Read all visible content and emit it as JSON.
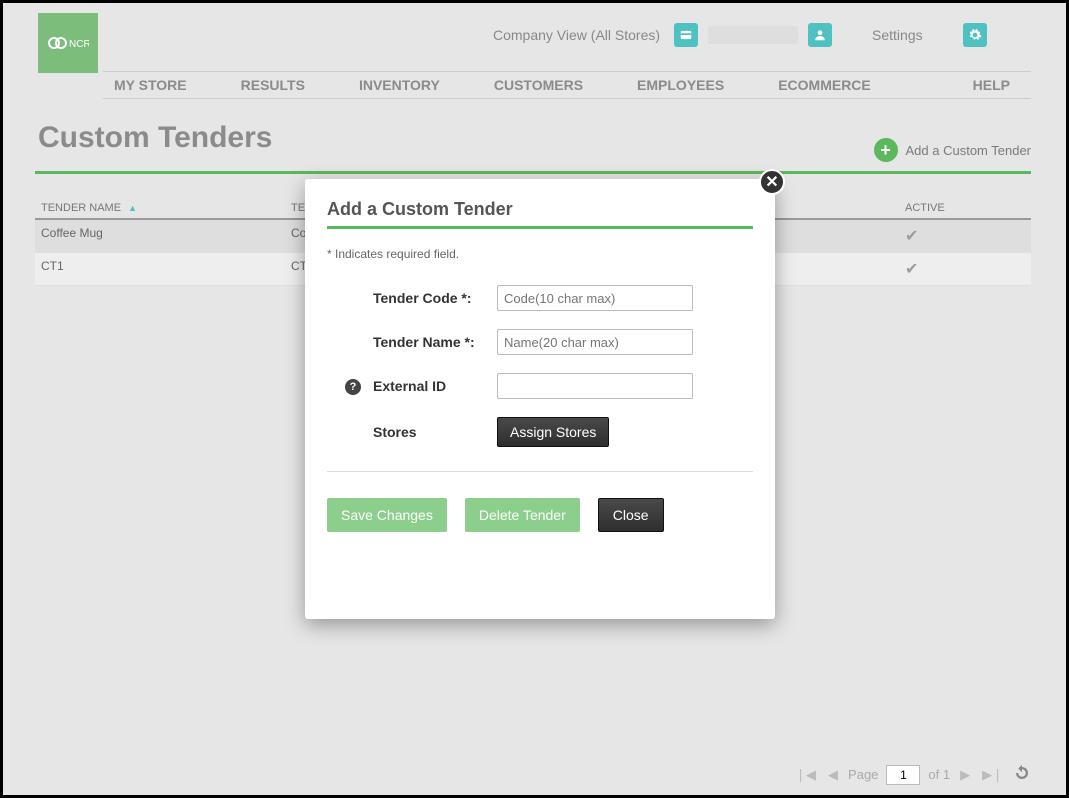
{
  "header": {
    "brand": "NCR",
    "company_view": "Company View (All Stores)",
    "settings": "Settings"
  },
  "nav": {
    "items": [
      "MY STORE",
      "RESULTS",
      "INVENTORY",
      "CUSTOMERS",
      "EMPLOYEES",
      "ECOMMERCE",
      "HELP"
    ]
  },
  "page": {
    "title": "Custom Tenders",
    "add_link": "Add a Custom Tender"
  },
  "table": {
    "headers": {
      "name": "TENDER NAME",
      "code": "TE",
      "active": "ACTIVE"
    },
    "rows": [
      {
        "name": "Coffee Mug",
        "code": "Co",
        "active": true
      },
      {
        "name": "CT1",
        "code": "CT",
        "active": true
      }
    ]
  },
  "modal": {
    "title": "Add a Custom Tender",
    "required_note": "* Indicates required field.",
    "labels": {
      "tender_code": "Tender Code *:",
      "tender_name": "Tender Name *:",
      "external_id": "External ID",
      "stores": "Stores"
    },
    "placeholders": {
      "code": "Code(10 char max)",
      "name": "Name(20 char max)"
    },
    "buttons": {
      "assign": "Assign Stores",
      "save": "Save Changes",
      "delete": "Delete Tender",
      "close": "Close"
    }
  },
  "pager": {
    "page_label": "Page",
    "page_value": "1",
    "of_label": "of 1"
  }
}
